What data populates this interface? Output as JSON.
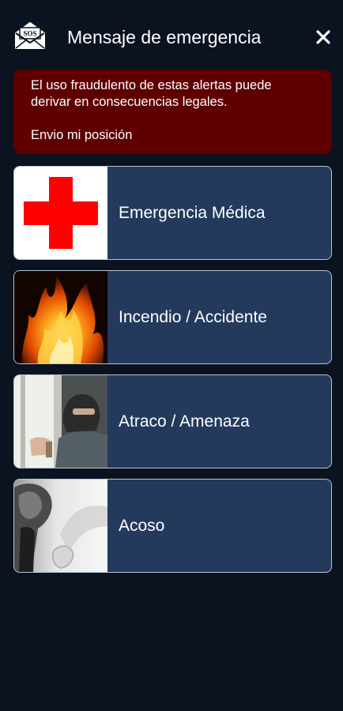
{
  "header": {
    "logo_text": "SOS",
    "title": "Mensaje de emergencia",
    "close_icon": "close-icon"
  },
  "warning": {
    "message": "El uso fraudulento de estas alertas puede derivar en consecuencias legales.",
    "send_position": "Envio mi posición",
    "background_color": "#5e0000"
  },
  "options": [
    {
      "label": "Emergencia Médica",
      "icon": "red-cross-icon"
    },
    {
      "label": "Incendio / Accidente",
      "icon": "fire-image"
    },
    {
      "label": "Atraco / Amenaza",
      "icon": "robber-image"
    },
    {
      "label": "Acoso",
      "icon": "harassment-image"
    }
  ],
  "colors": {
    "background": "#0b1220",
    "card": "#233a5c",
    "card_border": "#b9c3d0",
    "cross": "#ff0000"
  }
}
